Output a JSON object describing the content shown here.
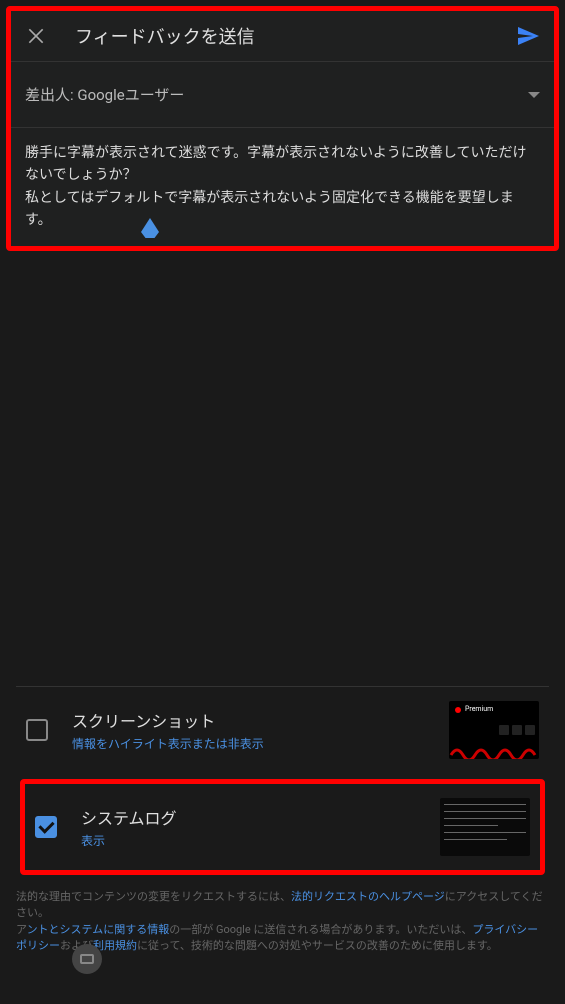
{
  "header": {
    "title": "フィードバックを送信"
  },
  "sender": {
    "label": "差出人: Googleユーザー"
  },
  "feedback": {
    "text": "勝手に字幕が表示されて迷惑です。字幕が表示されないように改善していただけないでしょうか？\n私としてはデフォルトで字幕が表示されないよう固定化できる機能を要望します。"
  },
  "attachments": {
    "screenshot": {
      "title": "スクリーンショット",
      "subtitle": "情報をハイライト表示または非表示",
      "checked": false,
      "thumb_label": "Premium"
    },
    "systemlog": {
      "title": "システムログ",
      "subtitle": "表示",
      "checked": true
    }
  },
  "legal": {
    "line1_prefix": "法的な理由でコンテンツの変更をリクエストするには、",
    "line1_link": "法的リクエストのヘルプページ",
    "line1_suffix": "にアクセスしてください。",
    "line2_prefix": "ア",
    "line2_link1": "ントとシステムに関する情報",
    "line2_mid1": "の一部が Google に送信される場合があります。いただい",
    "line2_mid2": "は、",
    "line2_link2": "プライバシー ポリシー",
    "line2_mid3": "および",
    "line2_link3": "利用規約",
    "line2_suffix": "に従って、技術的な問題への対処やサービスの改善のために使用します。"
  }
}
